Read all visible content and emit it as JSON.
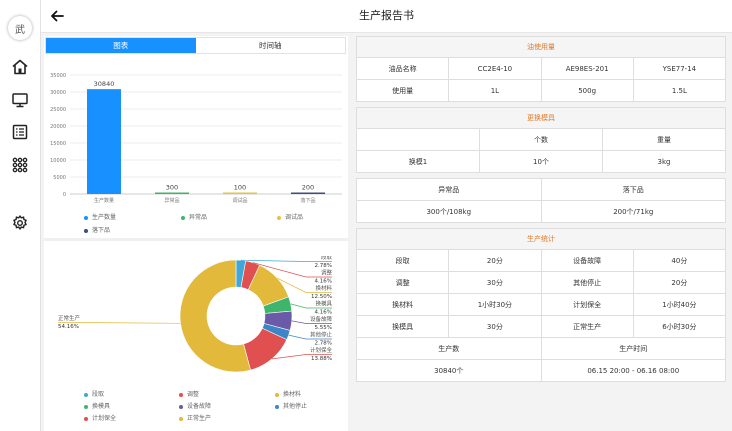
{
  "app": {
    "title": "生产报告书",
    "logo_text": "武"
  },
  "tabs": [
    {
      "label": "图表"
    },
    {
      "label": "时间轴"
    }
  ],
  "colors": {
    "accent": "#1890ff",
    "section_title": "#e07a2a"
  },
  "bar_legend": [
    {
      "label": "生产数量",
      "color": "#1890ff"
    },
    {
      "label": "异常品",
      "color": "#3fb56b"
    },
    {
      "label": "调试品",
      "color": "#e6c33a"
    },
    {
      "label": "落下品",
      "color": "#3c4f7a"
    }
  ],
  "pie_legend": [
    {
      "label": "段取",
      "color": "#41a6d8"
    },
    {
      "label": "调整",
      "color": "#e05050"
    },
    {
      "label": "换材料",
      "color": "#e2b93b"
    },
    {
      "label": "换模具",
      "color": "#3fb56b"
    },
    {
      "label": "设备故障",
      "color": "#6a5aa8"
    },
    {
      "label": "其他停止",
      "color": "#3d86c6"
    },
    {
      "label": "计划保全",
      "color": "#e05050"
    },
    {
      "label": "正常生产",
      "color": "#e2b93b"
    }
  ],
  "chart_data": [
    {
      "type": "bar",
      "categories": [
        "生产数量",
        "异常品",
        "调试品",
        "落下品"
      ],
      "values": [
        30840,
        300,
        100,
        200
      ],
      "colors": [
        "#1890ff",
        "#3fb56b",
        "#e6c33a",
        "#3c4f7a"
      ],
      "ylim": [
        0,
        35000
      ],
      "yticks": [
        0,
        5000,
        10000,
        15000,
        20000,
        25000,
        30000,
        35000
      ],
      "grid": true,
      "legend": "bottom"
    },
    {
      "type": "pie",
      "slices": [
        {
          "label": "段取",
          "percent": "2.78%",
          "value": 2.78,
          "color": "#41a6d8"
        },
        {
          "label": "调整",
          "percent": "4.16%",
          "value": 4.16,
          "color": "#e05050"
        },
        {
          "label": "换材料",
          "percent": "12.50%",
          "value": 12.5,
          "color": "#e2b93b"
        },
        {
          "label": "换模具",
          "percent": "4.16%",
          "value": 4.16,
          "color": "#3fb56b"
        },
        {
          "label": "设备故障",
          "percent": "5.55%",
          "value": 5.55,
          "color": "#6a5aa8"
        },
        {
          "label": "其他停止",
          "percent": "2.78%",
          "value": 2.78,
          "color": "#3d86c6"
        },
        {
          "label": "计划保全",
          "percent": "13.88%",
          "value": 13.88,
          "color": "#e05050"
        },
        {
          "label": "正常生产",
          "percent": "54.16%",
          "value": 54.16,
          "color": "#e2b93b"
        }
      ],
      "legend": "bottom"
    }
  ],
  "oil": {
    "title": "油使用量",
    "row1": [
      "油品名称",
      "CC2E4-10",
      "AE98ES-201",
      "YSE77-14"
    ],
    "row2": [
      "使用量",
      "1L",
      "500g",
      "1.5L"
    ]
  },
  "mold": {
    "title": "更换模具",
    "header": [
      "",
      "个数",
      "重量"
    ],
    "row": [
      "换模1",
      "10个",
      "3kg"
    ]
  },
  "defects": {
    "header": [
      "异常品",
      "落下品"
    ],
    "row": [
      "300个/108kg",
      "200个/71kg"
    ]
  },
  "stats": {
    "title": "生产统计",
    "rows": [
      [
        "段取",
        "20分",
        "设备故障",
        "40分"
      ],
      [
        "调整",
        "30分",
        "其他停止",
        "20分"
      ],
      [
        "换材料",
        "1小时30分",
        "计划保全",
        "1小时40分"
      ],
      [
        "换模具",
        "30分",
        "正常生产",
        "6小时30分"
      ]
    ],
    "footer_header": [
      "生产数",
      "生产时间"
    ],
    "footer_row": [
      "30840个",
      "06.15 20:00 - 06.16 08:00"
    ]
  }
}
